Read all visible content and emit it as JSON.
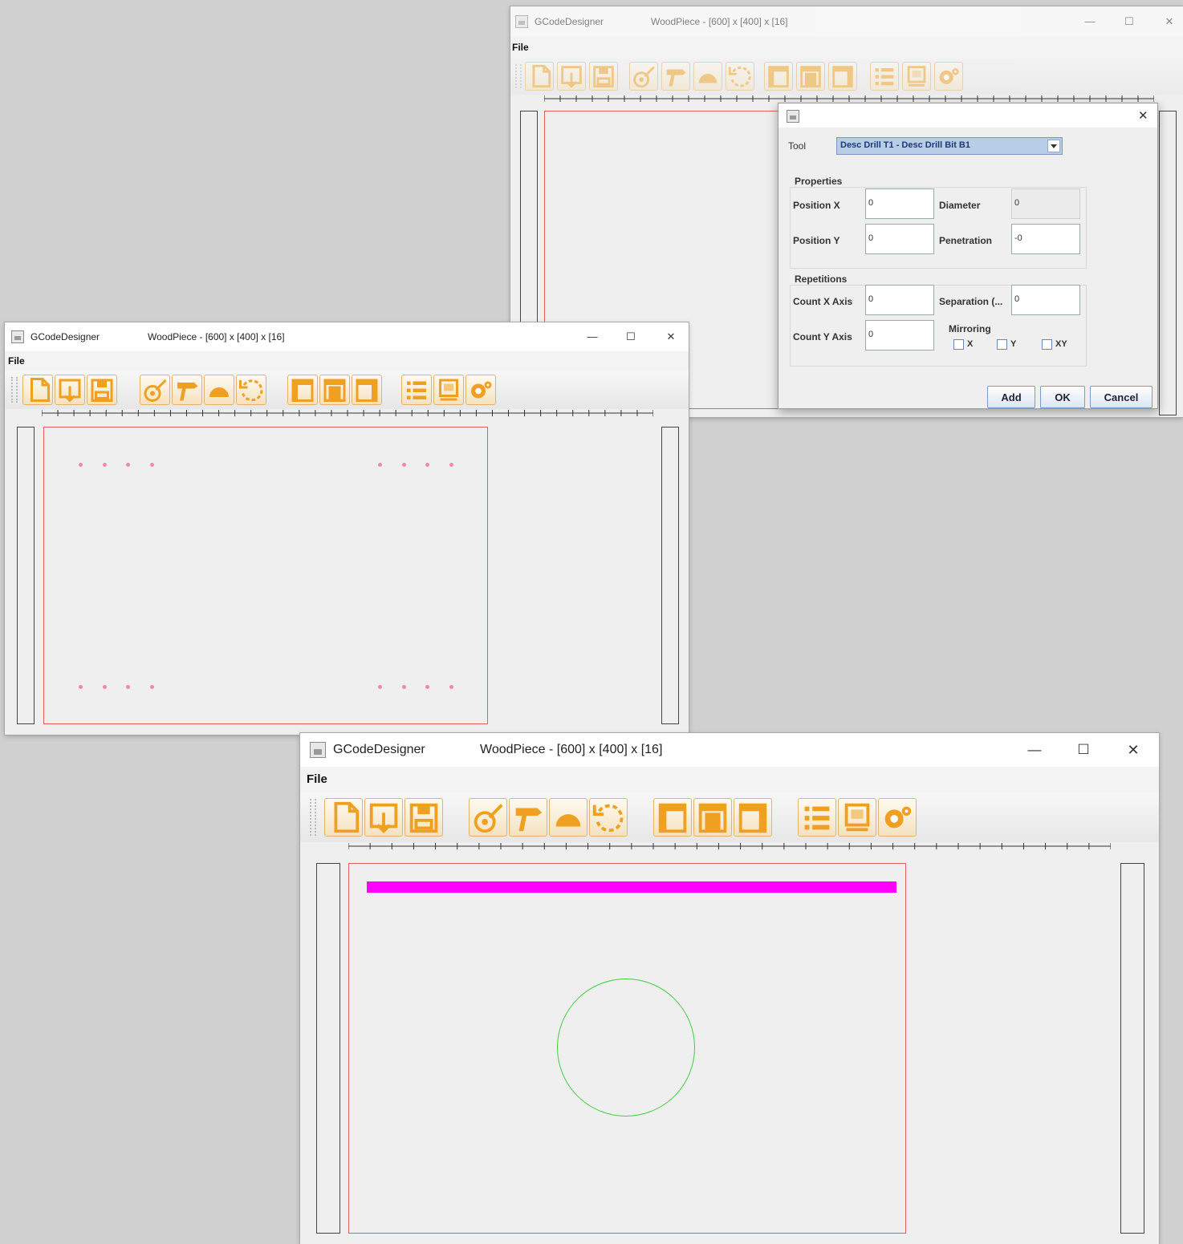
{
  "app_name": "GCodeDesigner",
  "document_title": "WoodPiece  -  [600] x [400] x [16]",
  "menu": {
    "file": "File"
  },
  "window_controls": {
    "minimize": "—",
    "maximize": "☐",
    "close": "✕"
  },
  "toolbar_icons": [
    "new-file-icon",
    "open-file-icon",
    "save-icon",
    "drill-icon",
    "drill-gun-icon",
    "arc-icon",
    "rotate-icon",
    "panel-front-icon",
    "panel-full-icon",
    "panel-back-icon",
    "list-icon",
    "report-icon",
    "settings-gear-icon"
  ],
  "colors": {
    "accent": "#f0a020",
    "board_border": "#e06060",
    "hole": "#f08aa0",
    "groove": "#ff00ff",
    "circle": "#40d040"
  },
  "dialog": {
    "close": "✕",
    "tool_label": "Tool",
    "tool_value": "Desc Drill T1 - Desc Drill Bit B1",
    "properties_title": "Properties",
    "position_x_label": "Position X",
    "position_x_value": "0",
    "position_y_label": "Position Y",
    "position_y_value": "0",
    "diameter_label": "Diameter",
    "diameter_value": "0",
    "penetration_label": "Penetration",
    "penetration_value": "-0",
    "repetitions_title": "Repetitions",
    "count_x_label": "Count X Axis",
    "count_x_value": "0",
    "count_y_label": "Count Y Axis",
    "count_y_value": "0",
    "separation_label": "Separation (...",
    "separation_value": "0",
    "mirroring_title": "Mirroring",
    "mirror_x": "X",
    "mirror_y": "Y",
    "mirror_xy": "XY",
    "add": "Add",
    "ok": "OK",
    "cancel": "Cancel"
  }
}
